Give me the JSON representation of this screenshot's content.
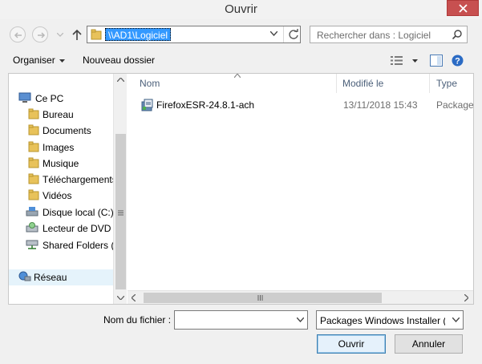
{
  "window": {
    "title": "Ouvrir"
  },
  "nav": {
    "address": "\\\\AD1\\Logiciel",
    "search_placeholder": "Rechercher dans : Logiciel"
  },
  "toolbar": {
    "organize": "Organiser",
    "new_folder": "Nouveau dossier"
  },
  "tree": {
    "items": [
      {
        "label": "Ce PC",
        "icon": "computer-icon"
      },
      {
        "label": "Bureau",
        "icon": "folder-icon"
      },
      {
        "label": "Documents",
        "icon": "folder-icon"
      },
      {
        "label": "Images",
        "icon": "folder-icon"
      },
      {
        "label": "Musique",
        "icon": "folder-icon"
      },
      {
        "label": "Téléchargements",
        "icon": "folder-icon"
      },
      {
        "label": "Vidéos",
        "icon": "folder-icon"
      },
      {
        "label": "Disque local (C:)",
        "icon": "drive-icon"
      },
      {
        "label": "Lecteur de DVD (",
        "icon": "dvd-icon"
      },
      {
        "label": "Shared Folders (\\",
        "icon": "network-drive-icon"
      },
      {
        "label": "Réseau",
        "icon": "network-icon"
      }
    ]
  },
  "list": {
    "columns": {
      "name": "Nom",
      "modified": "Modifié le",
      "type": "Type"
    },
    "files": [
      {
        "name": "FirefoxESR-24.8.1-ach",
        "modified": "13/11/2018 15:43",
        "type": "Package W"
      }
    ]
  },
  "bottom": {
    "filename_label": "Nom du fichier :",
    "filename_value": "",
    "filter": "Packages Windows Installer (*.m",
    "open": "Ouvrir",
    "cancel": "Annuler"
  },
  "colors": {
    "accent": "#3399ff",
    "close": "#c75050",
    "selection": "#e5f3fb",
    "header_text": "#4c607a"
  }
}
